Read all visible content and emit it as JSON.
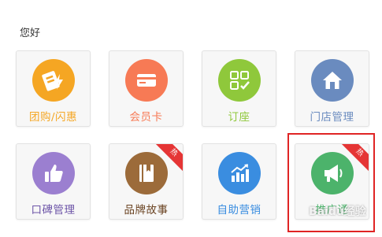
{
  "greeting": "您好",
  "tiles": [
    {
      "label": "团购/闪惠",
      "icon": "coupon-lightning-icon",
      "color": "#f5a623",
      "label_color": "#f5a623",
      "hot": false
    },
    {
      "label": "会员卡",
      "icon": "member-card-icon",
      "color": "#f77a55",
      "label_color": "#f77a55",
      "hot": false
    },
    {
      "label": "订座",
      "icon": "seat-booking-icon",
      "color": "#8fc83b",
      "label_color": "#8fc83b",
      "hot": false
    },
    {
      "label": "门店管理",
      "icon": "store-house-icon",
      "color": "#6a8bbf",
      "label_color": "#6a8bbf",
      "hot": false
    },
    {
      "label": "口碑管理",
      "icon": "thumbs-up-icon",
      "color": "#9b7fd0",
      "label_color": "#6d55a8",
      "hot": false
    },
    {
      "label": "品牌故事",
      "icon": "brand-book-icon",
      "color": "#9c6b3a",
      "label_color": "#6b4423",
      "hot": true
    },
    {
      "label": "自助营销",
      "icon": "growth-chart-icon",
      "color": "#3a8de0",
      "label_color": "#3a8de0",
      "hot": false
    },
    {
      "label": "推广通",
      "icon": "megaphone-icon",
      "color": "#4cb36b",
      "label_color": "#4cb36b",
      "hot": true
    }
  ],
  "hot_badge": "热",
  "watermark": "Baidu经验"
}
